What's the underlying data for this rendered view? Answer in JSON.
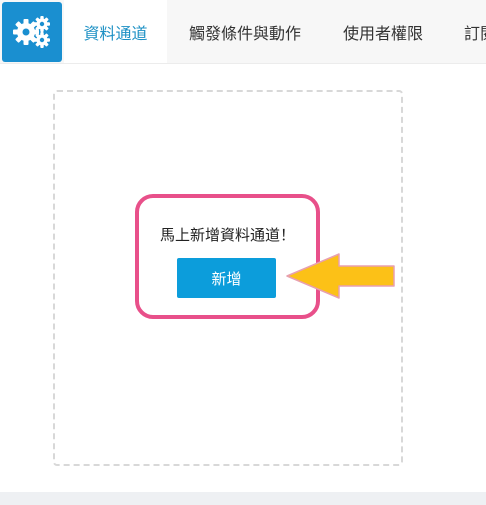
{
  "tabs": [
    {
      "label": "資料通道",
      "active": true
    },
    {
      "label": "觸發條件與動作",
      "active": false
    },
    {
      "label": "使用者權限",
      "active": false
    },
    {
      "label": "訂閱",
      "active": false
    }
  ],
  "main": {
    "prompt": "馬上新增資料通道！",
    "add_button_label": "新增"
  },
  "icons": {
    "app": "gears-icon",
    "annotation": "pointing-arrow-icon"
  },
  "colors": {
    "app_icon_bg": "#1a8fd0",
    "active_tab_text": "#1c90c4",
    "button": "#0c9ddb",
    "highlight_border": "#e8508a",
    "arrow_fill": "#fcc117"
  }
}
